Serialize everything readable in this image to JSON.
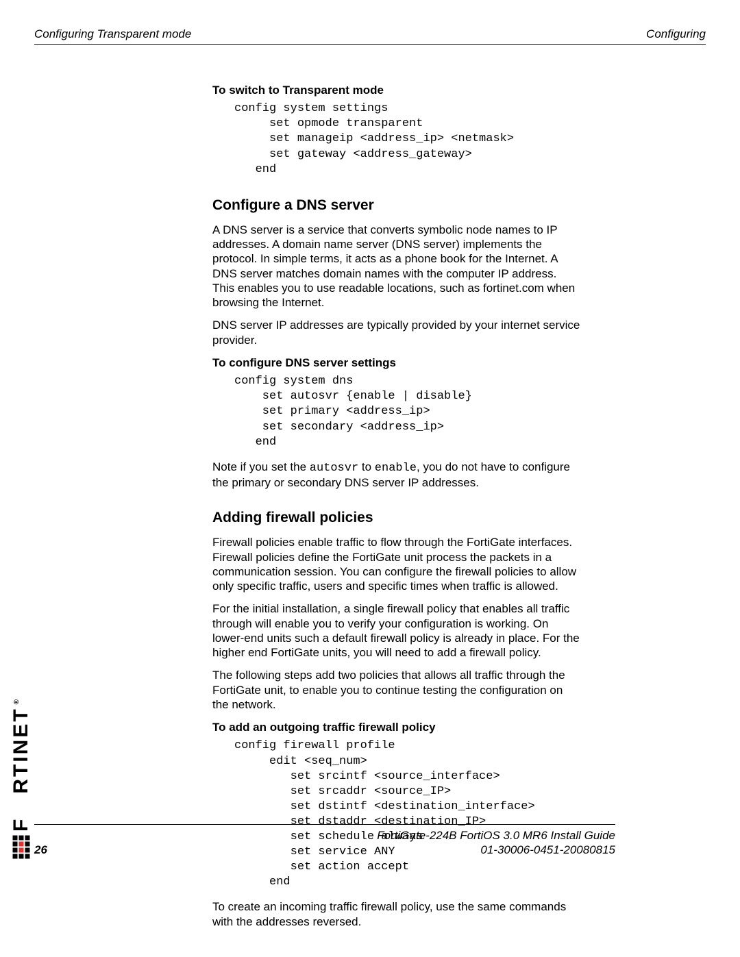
{
  "header": {
    "left": "Configuring Transparent mode",
    "right": "Configuring"
  },
  "section1": {
    "title": "To switch to Transparent mode",
    "code": "config system settings\n     set opmode transparent\n     set manageip <address_ip> <netmask>\n     set gateway <address_gateway>\n   end"
  },
  "section2": {
    "heading": "Configure a DNS server",
    "p1": "A DNS server is a service that converts symbolic node names to IP addresses. A domain name server (DNS server) implements the protocol. In simple terms, it acts as a phone book for the Internet. A DNS server matches domain names with the computer IP address. This enables you to use readable locations, such as fortinet.com when browsing the Internet.",
    "p2": "DNS server IP addresses are typically provided by your internet service provider.",
    "sub": "To configure DNS server settings",
    "code": "config system dns\n    set autosvr {enable | disable}\n    set primary <address_ip>\n    set secondary <address_ip>\n   end",
    "note_pre": "Note if you set the ",
    "note_code1": "autosvr",
    "note_mid": " to ",
    "note_code2": "enable",
    "note_post": ", you do not have to configure the primary or secondary DNS server IP addresses."
  },
  "section3": {
    "heading": "Adding firewall policies",
    "p1": "Firewall policies enable traffic to flow through the FortiGate interfaces. Firewall policies define the FortiGate unit process the packets in a communication session. You can configure the firewall policies to allow only specific traffic, users and specific times when traffic is allowed.",
    "p2": "For the initial installation, a single firewall policy that enables all traffic through will enable you to verify your configuration is working. On lower-end units such a default firewall policy is already in place. For the higher end FortiGate units, you will need to add a firewall policy.",
    "p3": "The following steps add two policies that allows all traffic through the FortiGate unit, to enable you to continue testing the configuration on the network.",
    "sub": "To add an outgoing traffic firewall policy",
    "code": "config firewall profile\n     edit <seq_num>\n        set srcintf <source_interface>\n        set srcaddr <source_IP>\n        set dstintf <destination_interface>\n        set dstaddr <destination_IP>\n        set schedule always\n        set service ANY\n        set action accept\n     end",
    "p4": "To create an incoming traffic firewall policy, use the same commands with the addresses reversed."
  },
  "brand": "F   RTINET",
  "brand_trademark": "®",
  "footer": {
    "line1": "FortiGate-224B FortiOS 3.0 MR6 Install Guide",
    "line2": "01-30006-0451-20080815",
    "page": "26"
  }
}
